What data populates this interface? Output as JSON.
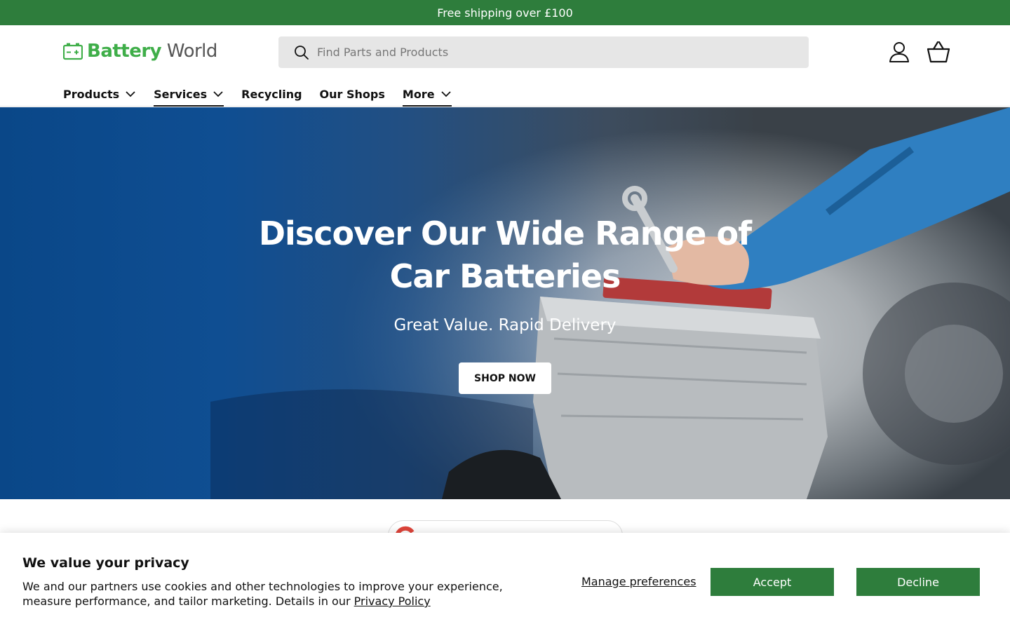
{
  "announcement": {
    "text": "Free shipping over £100"
  },
  "header": {
    "logo": {
      "word1": "Battery",
      "word2": "World"
    },
    "search": {
      "placeholder": "Find Parts and Products"
    },
    "icons": {
      "account": "user-icon",
      "basket": "basket-icon"
    }
  },
  "nav": {
    "items": [
      {
        "label": "Products",
        "has_dropdown": true,
        "active": false
      },
      {
        "label": "Services",
        "has_dropdown": true,
        "active": true
      },
      {
        "label": "Recycling",
        "has_dropdown": false,
        "active": false
      },
      {
        "label": "Our Shops",
        "has_dropdown": false,
        "active": false
      },
      {
        "label": "More",
        "has_dropdown": true,
        "active": true
      }
    ]
  },
  "hero": {
    "title_line1": "Discover Our Wide Range of",
    "title_line2": "Car Batteries",
    "subtitle": "Great Value. Rapid Delivery",
    "cta": "SHOP NOW"
  },
  "cookie_banner": {
    "title": "We value your privacy",
    "text": "We and our partners use cookies and other technologies to improve your experience, measure performance, and tailor marketing. Details in our ",
    "link": "Privacy Policy",
    "manage": "Manage preferences",
    "accept": "Accept",
    "decline": "Decline"
  },
  "colors": {
    "brand_green": "#2e7d3c",
    "logo_green": "#3fae49",
    "hero_blue": "#0f4e92"
  }
}
